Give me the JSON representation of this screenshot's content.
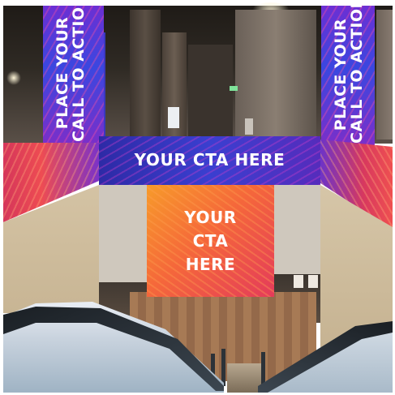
{
  "signage": {
    "vertical_left": [
      "PLACE YOUR",
      "CALL TO ACTION"
    ],
    "vertical_right": [
      "PLACE YOUR",
      "CALL TO ACTION"
    ],
    "cta_top": "YOUR CTA HERE",
    "cta_center": [
      "YOUR",
      "CTA",
      "HERE"
    ]
  },
  "colors": {
    "banner_purple": "#3a47e0",
    "banner_orange": "#f5683a",
    "banner_red": "#e43b5a",
    "wall_beige": "#cfc8bd"
  }
}
